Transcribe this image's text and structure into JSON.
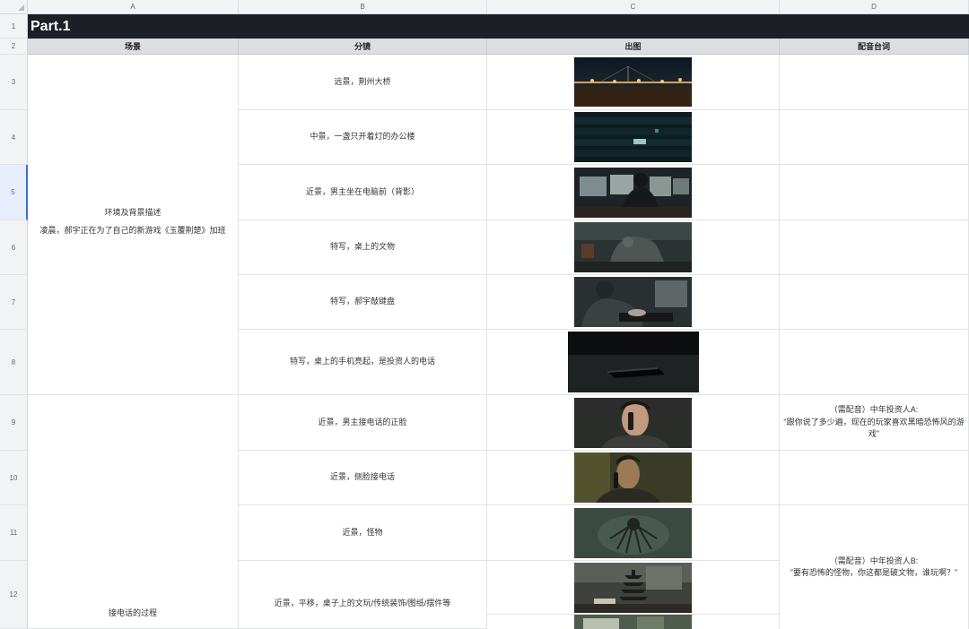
{
  "columns": [
    "A",
    "B",
    "C",
    "D"
  ],
  "row_numbers": [
    "1",
    "2",
    "3",
    "4",
    "5",
    "6",
    "7",
    "8",
    "9",
    "10",
    "11",
    "12"
  ],
  "title": "Part.1",
  "headers": {
    "scene": "场景",
    "shot": "分镜",
    "image": "出图",
    "dialogue": "配音台词"
  },
  "scenes": [
    {
      "line1": "环境及背景描述",
      "line2": "凌晨，郝宇正在为了自己的新游戏《玉覆荆楚》加班"
    },
    {
      "line1": "接电话的过程"
    }
  ],
  "shots": [
    "远景，荆州大桥",
    "中景，一盏只开着灯的办公楼",
    "近景，男主坐在电脑前（背影）",
    "特写，桌上的文物",
    "特写，郝宇敲键盘",
    "特写，桌上的手机亮起，是投资人的电话",
    "近景，男主接电话的正脸",
    "近景，侧脸接电话",
    "近景，怪物",
    "近景，平移，桌子上的文玩/传统装饰/图纸/摆件等"
  ],
  "images": [
    "bridge-night",
    "office-building",
    "man-at-computer",
    "desk-artifact",
    "typing-keyboard",
    "phone-on-desk",
    "man-phone-front",
    "man-phone-side",
    "monster",
    "pagoda-ornament",
    "desk-items"
  ],
  "dialogues": [
    {
      "speaker": "（需配音）中年投资人A:",
      "text": "\"跟你说了多少遍，现在的玩家喜欢黑暗恐怖风的游戏\""
    },
    {
      "speaker": "（需配音）中年投资人B:",
      "text": "\"要有恐怖的怪物，你这都是破文物，谁玩啊？\""
    }
  ],
  "colors": {
    "title_bar": "#1d1f26",
    "header_row": "#dcdee2",
    "active_row": "#3b6fd8"
  }
}
